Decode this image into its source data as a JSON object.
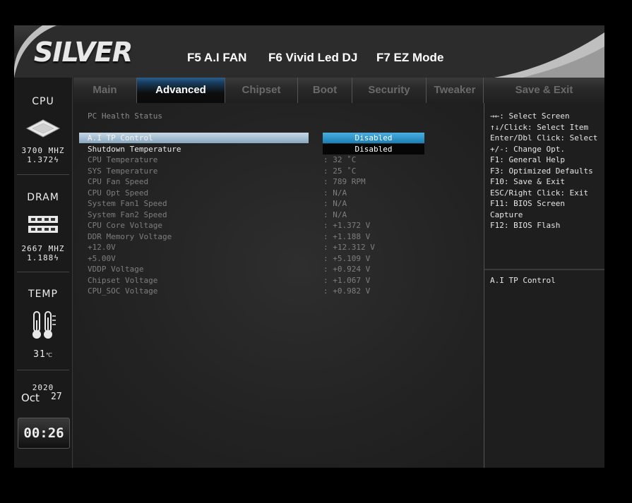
{
  "header": {
    "logo": "SILVER",
    "fkeys": [
      "F5 A.I FAN",
      "F6 Vivid Led DJ",
      "F7 EZ Mode"
    ]
  },
  "sidebar": {
    "cpu": {
      "title": "CPU",
      "freq": "3700 MHZ",
      "volt": "1.372"
    },
    "dram": {
      "title": "DRAM",
      "freq": "2667 MHZ",
      "volt": "1.188"
    },
    "temp": {
      "title": "TEMP",
      "value": "31"
    },
    "date": {
      "year": "2020",
      "month": "Oct",
      "day": "27"
    },
    "clock": "00:26"
  },
  "tabs": [
    {
      "label": "Main"
    },
    {
      "label": "Advanced"
    },
    {
      "label": "Chipset"
    },
    {
      "label": "Boot"
    },
    {
      "label": "Security"
    },
    {
      "label": "Tweaker"
    },
    {
      "label": "Save & Exit"
    }
  ],
  "main": {
    "section_title": "PC Health Status",
    "selected_item": {
      "label": "A.I TP Control",
      "value": "Disabled"
    },
    "shutdown_item": {
      "label": "Shutdown Temperature",
      "value": "Disabled"
    },
    "readings": [
      {
        "label": "CPU Temperature",
        "value": ": 32 ˚C"
      },
      {
        "label": "SYS Temperature",
        "value": ": 25 ˚C"
      },
      {
        "label": "CPU Fan Speed",
        "value": ": 789 RPM"
      },
      {
        "label": "CPU Opt Speed",
        "value": ": N/A"
      },
      {
        "label": "System Fan1 Speed",
        "value": ": N/A"
      },
      {
        "label": "System Fan2 Speed",
        "value": ": N/A"
      },
      {
        "label": "CPU Core Voltage",
        "value": ": +1.372 V"
      },
      {
        "label": "DDR Memory Voltage",
        "value": ": +1.188 V"
      },
      {
        "label": "+12.0V",
        "value": ": +12.312 V"
      },
      {
        "label": "+5.00V",
        "value": ": +5.109 V"
      },
      {
        "label": "VDDP Voltage",
        "value": ": +0.924 V"
      },
      {
        "label": "Chipset Voltage",
        "value": ": +1.067 V"
      },
      {
        "label": "CPU_SOC Voltage",
        "value": ": +0.982 V"
      }
    ]
  },
  "help": {
    "keys": [
      "→←: Select Screen",
      "↑↓/Click: Select Item",
      "Enter/Dbl Click: Select",
      "+/-: Change Opt.",
      "F1: General Help",
      "F3: Optimized Defaults",
      "F10: Save & Exit",
      "ESC/Right Click: Exit",
      "F11: BIOS Screen",
      "Capture",
      "F12: BIOS Flash"
    ],
    "description": "A.I TP Control"
  },
  "colors": {
    "highlight": "#a9c1d6",
    "option_active": "#2a8fc0",
    "tab_active": "#1f4d78",
    "text_dim": "#7e7e7e"
  }
}
